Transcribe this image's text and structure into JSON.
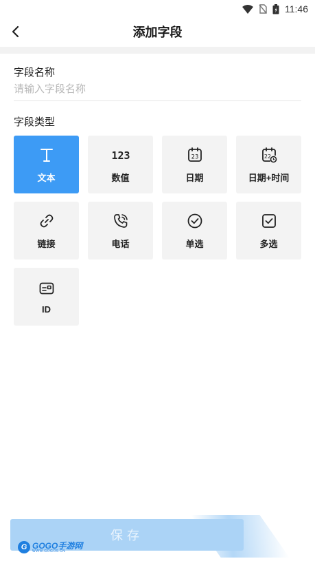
{
  "status_bar": {
    "time": "11:46"
  },
  "header": {
    "title": "添加字段"
  },
  "form": {
    "name_label": "字段名称",
    "name_placeholder": "请输入字段名称",
    "name_value": "",
    "type_label": "字段类型"
  },
  "field_types": [
    {
      "label": "文本",
      "icon": "text-icon",
      "active": true
    },
    {
      "label": "数值",
      "icon": "number-icon",
      "active": false
    },
    {
      "label": "日期",
      "icon": "calendar-icon",
      "active": false
    },
    {
      "label": "日期+时间",
      "icon": "calendar-clock-icon",
      "active": false
    },
    {
      "label": "链接",
      "icon": "link-icon",
      "active": false
    },
    {
      "label": "电话",
      "icon": "phone-icon",
      "active": false
    },
    {
      "label": "单选",
      "icon": "radio-check-icon",
      "active": false
    },
    {
      "label": "多选",
      "icon": "checkbox-icon",
      "active": false
    },
    {
      "label": "ID",
      "icon": "id-card-icon",
      "active": false
    }
  ],
  "footer": {
    "save_label": "保存"
  },
  "watermark": {
    "text": "GOGO手游网",
    "url": "WWW.GOGO9.CN"
  },
  "colors": {
    "accent": "#3d9bf5",
    "tile_bg": "#f3f3f3",
    "save_bg": "#abd3f6"
  }
}
